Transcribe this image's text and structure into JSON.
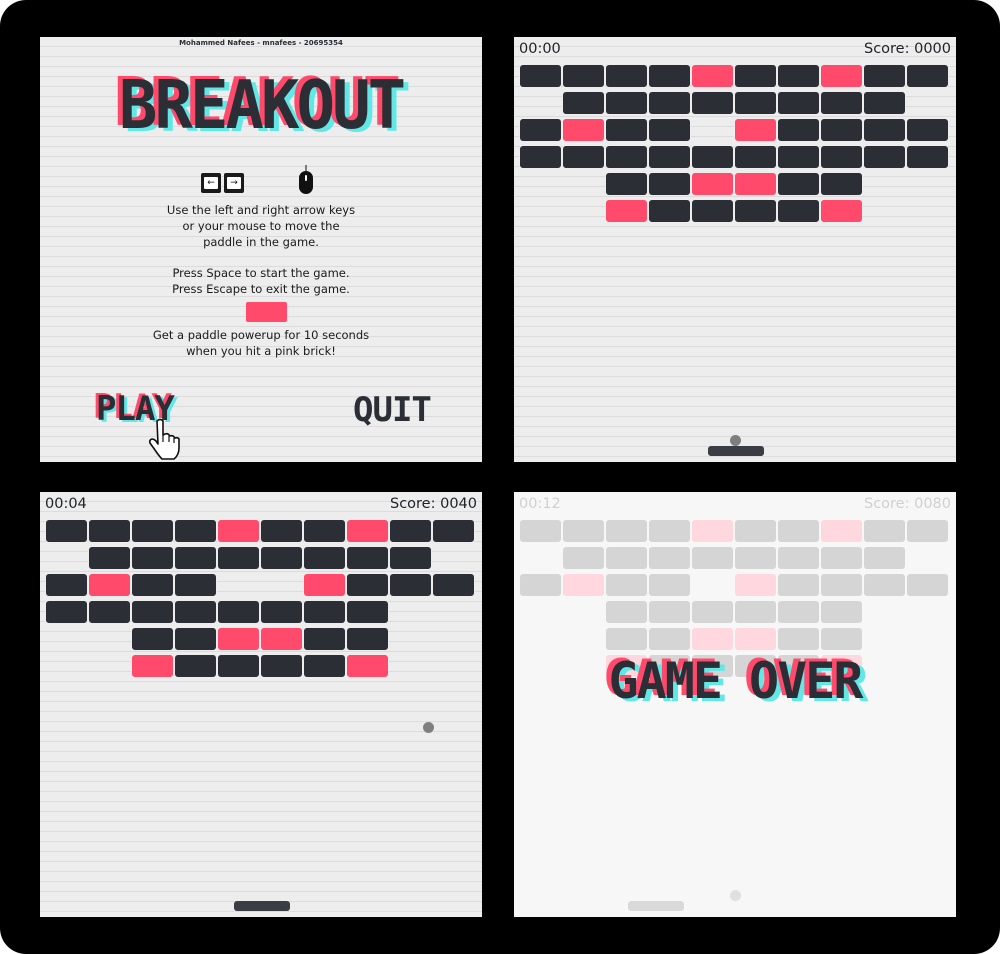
{
  "menu": {
    "author": "Mohammed Nafees - mnafees - 20695354",
    "title": "BREAKOUT",
    "key_left": "←",
    "key_right": "→",
    "keys_icon": "arrow-keys-icon",
    "mouse_icon": "mouse-icon",
    "instructions_line1": "Use the left and right arrow keys",
    "instructions_line2": "or your mouse to move the",
    "instructions_line3": "paddle in the game.",
    "space_line": "Press Space to start the game.",
    "escape_line": "Press Escape to exit the game.",
    "powerup_line1": "Get a paddle powerup for 10 seconds",
    "powerup_line2": "when you hit a pink brick!",
    "play_label": "PLAY",
    "quit_label": "QUIT",
    "cursor_icon": "hand-pointer-icon"
  },
  "colors": {
    "brick": "#2b2e35",
    "pink": "#ff4a6c",
    "cyan": "#62e7e7",
    "background": "#ededed"
  },
  "brick_rows": [
    "DDDDPDDPDD",
    ".DDDDDDDD.",
    "DPDD.PDDDD",
    "DDDDDDDDDD",
    "..DDPPDD..",
    "..PDDDDP.."
  ],
  "brick_rows_state3": [
    "DDDDPDDPDD",
    ".DDDDDDDD.",
    "DPDD..PDDD",
    "DDDDDDDD..",
    "..DDPPDD..",
    "..PDDDDP.."
  ],
  "brick_rows_state4": [
    "DDDDPDDPDD",
    ".DDDDDDDD.",
    "DPDD.PDDDD",
    "..DDDDDD..",
    "..DDPPDD..",
    "..PDDDDP.."
  ],
  "game_start": {
    "time": "00:00",
    "score": "Score: 0000"
  },
  "game_playing": {
    "time": "00:04",
    "score": "Score: 0040"
  },
  "game_over": {
    "time": "00:12",
    "score": "Score: 0080",
    "message": "GAME OVER"
  }
}
